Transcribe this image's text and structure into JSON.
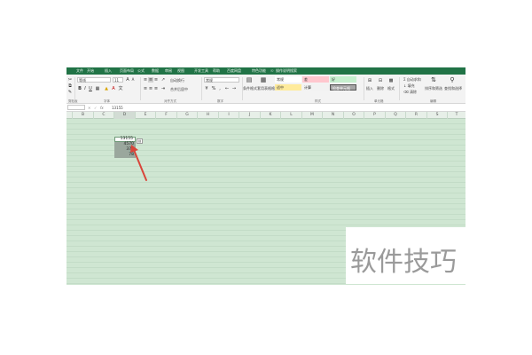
{
  "ribbon": {
    "tabs": [
      "文件",
      "开始",
      "插入",
      "页面布局",
      "公式",
      "数据",
      "审阅",
      "视图",
      "开发工具",
      "帮助",
      "百度网盘",
      "特色功能",
      "操作说明搜索"
    ],
    "font_name": "等线",
    "font_size": "11",
    "group_labels": [
      "剪贴板",
      "字体",
      "对齐方式",
      "数字",
      "样式",
      "单元格",
      "编辑"
    ],
    "wrap_text": "自动换行",
    "merge_center": "合并后居中",
    "number_format": "常规",
    "conditional_format": "条件格式",
    "format_as_table": "套用表格格式",
    "styles": [
      {
        "label": "常规",
        "color": "#ffffff"
      },
      {
        "label": "差",
        "color": "#ffc7ce"
      },
      {
        "label": "好",
        "color": "#c6efce"
      },
      {
        "label": "适中",
        "color": "#ffeb9c"
      },
      {
        "label": "计算",
        "color": "#f2f2f2"
      },
      {
        "label": "检查单元格",
        "color": "#a5a5a5"
      }
    ],
    "cells_buttons": [
      "插入",
      "删除",
      "格式"
    ],
    "editing": [
      "自动求和",
      "填充",
      "清除",
      "排序和筛选",
      "查找和选择"
    ]
  },
  "formula_bar": {
    "name_box": "",
    "fx": "fx",
    "value": "13155"
  },
  "columns": [
    "B",
    "C",
    "D",
    "E",
    "F",
    "G",
    "H",
    "I",
    "J",
    "K",
    "L",
    "M",
    "N",
    "O",
    "P",
    "Q",
    "R",
    "S",
    "T"
  ],
  "cells": [
    "13155",
    "4570",
    "370",
    "78"
  ],
  "quick_analysis_icon": "quick-analysis-icon",
  "colors": {
    "accent": "#217346",
    "sheet_bg": "#cfe6d2",
    "selection": "#9aa79d",
    "arrow": "#d9453a"
  },
  "watermark": "软件技巧"
}
